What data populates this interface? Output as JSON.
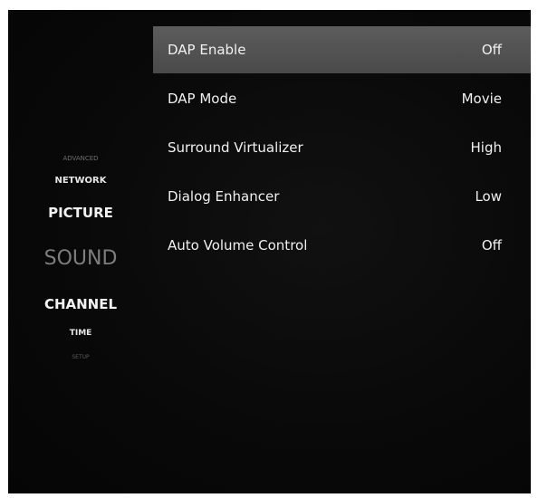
{
  "sidebar": {
    "items": [
      {
        "label": "ADVANCED"
      },
      {
        "label": "NETWORK"
      },
      {
        "label": "PICTURE"
      },
      {
        "label": "SOUND"
      },
      {
        "label": "CHANNEL"
      },
      {
        "label": "TIME"
      },
      {
        "label": "SETUP"
      }
    ],
    "selected": "SOUND"
  },
  "menu": {
    "rows": [
      {
        "label": "DAP Enable",
        "value": "Off"
      },
      {
        "label": "DAP Mode",
        "value": "Movie"
      },
      {
        "label": "Surround Virtualizer",
        "value": "High"
      },
      {
        "label": "Dialog Enhancer",
        "value": "Low"
      },
      {
        "label": "Auto Volume Control",
        "value": "Off"
      }
    ],
    "highlighted_row": "DAP Enable"
  },
  "colors": {
    "background": "#0a0a0a",
    "highlight": "#555555",
    "text": "#f0f0f0",
    "dim_text": "#7d7d7d"
  }
}
